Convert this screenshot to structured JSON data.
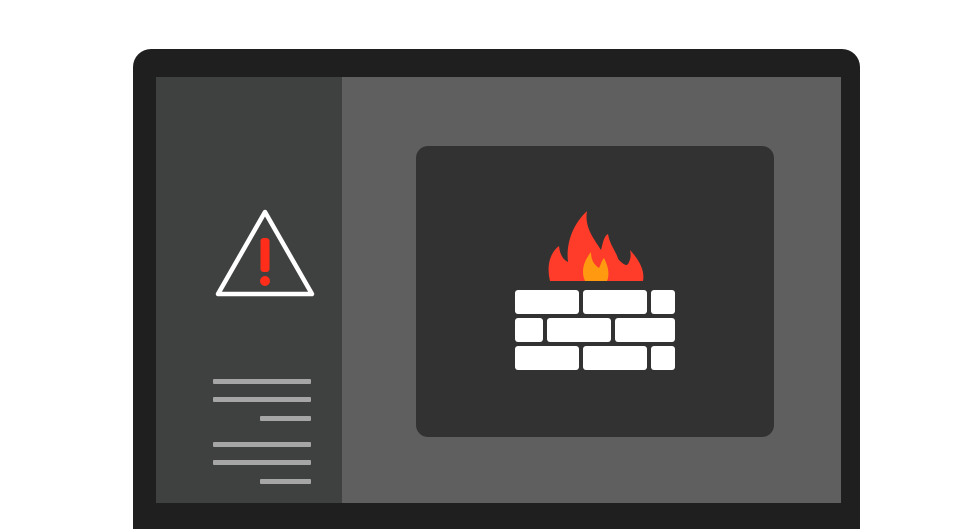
{
  "colors": {
    "device_frame": "#1e1f1e",
    "screen_background": "#5f5f5f",
    "sidebar_background": "#3f4140",
    "panel_background": "#323232",
    "warning_stroke": "#ffffff",
    "warning_mark": "#ff2d1a",
    "text_line": "#a6a6a6",
    "flame_outer": "#ff3c2a",
    "flame_inner": "#ff9a10",
    "brick": "#ffffff"
  },
  "icons": {
    "warning": "warning-triangle-icon",
    "firewall": "firewall-icon",
    "flame": "flame-icon",
    "brick_wall": "brick-wall-icon"
  },
  "sidebar": {
    "text_line_groups": 2,
    "lines_per_group": 3
  }
}
